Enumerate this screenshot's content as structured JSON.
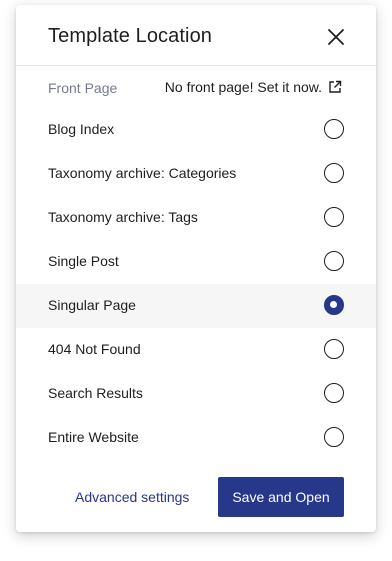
{
  "dialog": {
    "title": "Template Location",
    "close_icon": "close-icon"
  },
  "front_page": {
    "label": "Front Page",
    "link_text": "No front page! Set it now.",
    "link_icon": "external-link-icon"
  },
  "options": [
    {
      "label": "Blog Index",
      "selected": false
    },
    {
      "label": "Taxonomy archive: Categories",
      "selected": false
    },
    {
      "label": "Taxonomy archive: Tags",
      "selected": false
    },
    {
      "label": "Single Post",
      "selected": false
    },
    {
      "label": "Singular Page",
      "selected": true
    },
    {
      "label": "404 Not Found",
      "selected": false
    },
    {
      "label": "Search Results",
      "selected": false
    },
    {
      "label": "Entire Website",
      "selected": false
    }
  ],
  "footer": {
    "advanced_label": "Advanced settings",
    "save_label": "Save and Open"
  },
  "colors": {
    "accent": "#27378a",
    "muted_text": "#757b86",
    "selected_row_bg": "#f6f6f6"
  }
}
